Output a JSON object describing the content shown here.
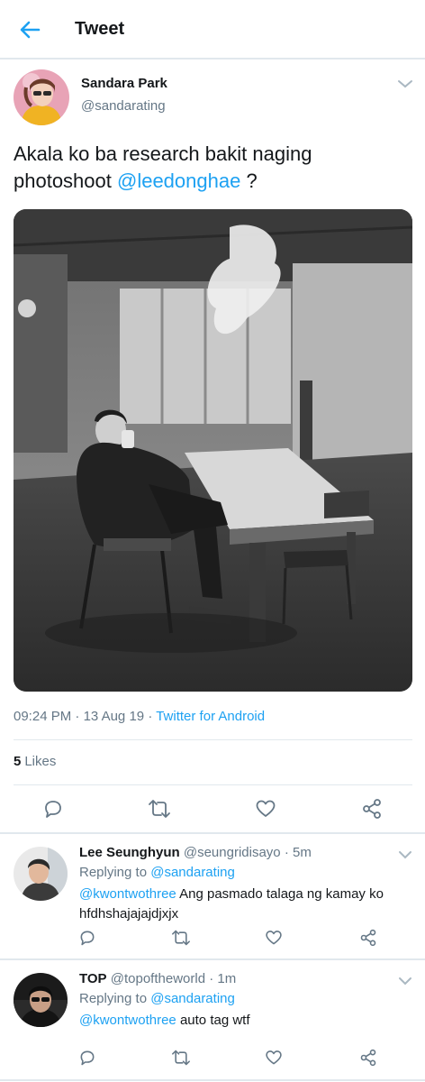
{
  "header": {
    "title": "Tweet"
  },
  "tweet": {
    "author_name": "Sandara Park",
    "author_handle": "@sandarating",
    "text_before": "Akala ko ba research bakit naging photoshoot ",
    "text_mention": "@leedonghae",
    "text_after": " ?",
    "time": "09:24 PM",
    "date": "13 Aug 19",
    "client": "Twitter for Android",
    "likes_count": "5",
    "likes_label": "Likes"
  },
  "replies": [
    {
      "name": "Lee Seunghyun",
      "handle": "@seungridisayo",
      "time": "5m",
      "replying_label": "Replying to",
      "replying_to": "@sandarating",
      "mention": "@kwontwothree",
      "text": "Ang pasmado talaga ng kamay ko hfdhshajajajdjxjx"
    },
    {
      "name": "TOP",
      "handle": "@topoftheworld",
      "time": "1m",
      "replying_label": "Replying to",
      "replying_to": "@sandarating",
      "mention": "@kwontwothree",
      "text": "auto tag wtf"
    }
  ],
  "icons": [
    "back-arrow-icon",
    "chevron-down-icon",
    "reply-icon",
    "retweet-icon",
    "like-icon",
    "share-icon"
  ],
  "colors": {
    "accent": "#1da1f2",
    "muted": "#657786",
    "text": "#14171a",
    "divider": "#e1e8ed"
  }
}
